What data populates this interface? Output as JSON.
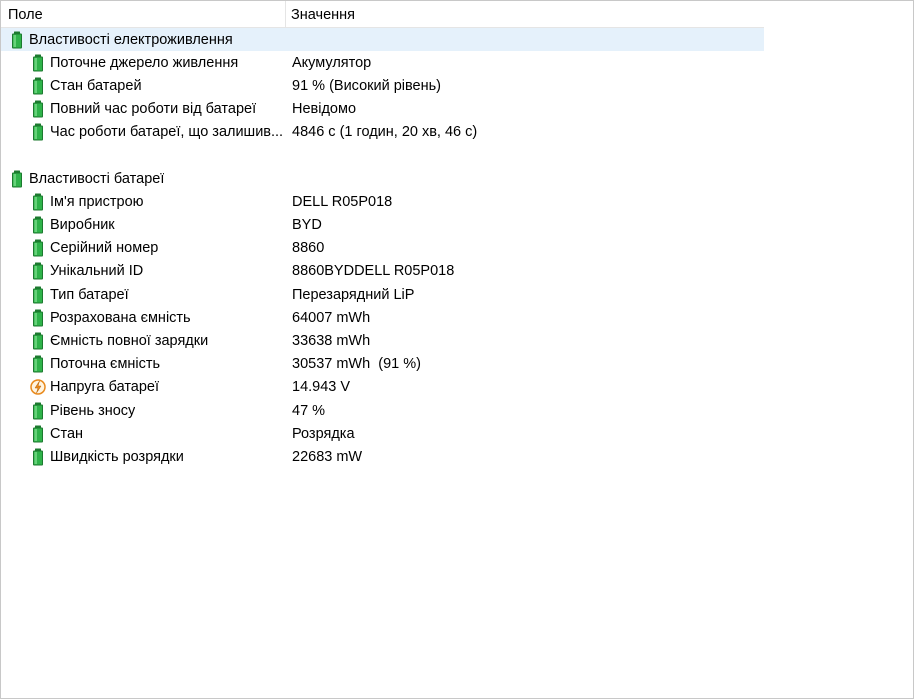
{
  "columns": {
    "field": "Поле",
    "value": "Значення"
  },
  "colors": {
    "battery_green": "#2fb34a",
    "battery_dark": "#1c7a2f",
    "selection": "#e5f1fb",
    "voltage_orange": "#e8891c"
  },
  "groups": [
    {
      "label": "Властивості електроживлення",
      "icon": "battery-icon",
      "items": [
        {
          "label": "Поточне джерело живлення",
          "value": "Акумулятор",
          "icon": "battery-icon"
        },
        {
          "label": "Стан батарей",
          "value": "91 % (Високий рівень)",
          "icon": "battery-icon"
        },
        {
          "label": "Повний час роботи від батареї",
          "value": "Невідомо",
          "icon": "battery-icon"
        },
        {
          "label": "Час роботи батареї, що залишив...",
          "value": "4846 с (1 годин, 20 хв, 46 с)",
          "icon": "battery-icon"
        }
      ]
    },
    {
      "label": "Властивості батареї",
      "icon": "battery-icon",
      "items": [
        {
          "label": "Ім'я пристрою",
          "value": "DELL R05P018",
          "icon": "battery-icon"
        },
        {
          "label": "Виробник",
          "value": "BYD",
          "icon": "battery-icon"
        },
        {
          "label": "Серійний номер",
          "value": "8860",
          "icon": "battery-icon"
        },
        {
          "label": "Унікальний ID",
          "value": "8860BYDDELL R05P018",
          "icon": "battery-icon"
        },
        {
          "label": "Тип батареї",
          "value": "Перезарядний LiP",
          "icon": "battery-icon"
        },
        {
          "label": "Розрахована ємність",
          "value": "64007 mWh",
          "icon": "battery-icon"
        },
        {
          "label": "Ємність повної зарядки",
          "value": "33638 mWh",
          "icon": "battery-icon"
        },
        {
          "label": "Поточна ємність",
          "value": "30537 mWh  (91 %)",
          "icon": "battery-icon"
        },
        {
          "label": "Напруга батареї",
          "value": "14.943 V",
          "icon": "voltage-icon"
        },
        {
          "label": "Рівень зносу",
          "value": "47 %",
          "icon": "battery-icon"
        },
        {
          "label": "Стан",
          "value": "Розрядка",
          "icon": "battery-icon"
        },
        {
          "label": "Швидкість розрядки",
          "value": "22683 mW",
          "icon": "battery-icon"
        }
      ]
    }
  ]
}
